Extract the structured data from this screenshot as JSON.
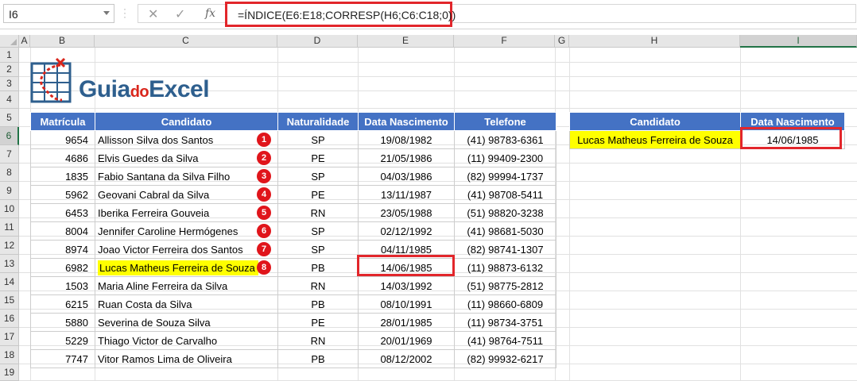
{
  "formula_bar": {
    "name_box": "I6",
    "formula": "=ÍNDICE(E6:E18;CORRESP(H6;C6:C18;0))"
  },
  "columns": [
    "A",
    "B",
    "C",
    "D",
    "E",
    "F",
    "G",
    "H",
    "I"
  ],
  "rows": [
    "1",
    "2",
    "3",
    "4",
    "5",
    "6",
    "7",
    "8",
    "9",
    "10",
    "11",
    "12",
    "13",
    "14",
    "15",
    "16",
    "17",
    "18",
    "19"
  ],
  "logo": {
    "part1": "Guia",
    "part2": "do",
    "part3": "Excel"
  },
  "main_table": {
    "headers": [
      "Matrícula",
      "Candidato",
      "Naturalidade",
      "Data Nascimento",
      "Telefone"
    ],
    "rows": [
      {
        "matricula": "9654",
        "candidato": "Allisson Silva dos Santos",
        "badge": "1",
        "nat": "SP",
        "data": "19/08/1982",
        "tel": "(41) 98783-6361"
      },
      {
        "matricula": "4686",
        "candidato": "Elvis Guedes da Silva",
        "badge": "2",
        "nat": "PE",
        "data": "21/05/1986",
        "tel": "(11) 99409-2300"
      },
      {
        "matricula": "1835",
        "candidato": "Fabio Santana da Silva Filho",
        "badge": "3",
        "nat": "SP",
        "data": "04/03/1986",
        "tel": "(82) 99994-1737"
      },
      {
        "matricula": "5962",
        "candidato": "Geovani Cabral da Silva",
        "badge": "4",
        "nat": "PE",
        "data": "13/11/1987",
        "tel": "(41) 98708-5411"
      },
      {
        "matricula": "6453",
        "candidato": "Iberika Ferreira Gouveia",
        "badge": "5",
        "nat": "RN",
        "data": "23/05/1988",
        "tel": "(51) 98820-3238"
      },
      {
        "matricula": "8004",
        "candidato": "Jennifer Caroline Hermógenes",
        "badge": "6",
        "nat": "SP",
        "data": "02/12/1992",
        "tel": "(41) 98681-5030"
      },
      {
        "matricula": "8974",
        "candidato": "Joao Victor Ferreira dos Santos",
        "badge": "7",
        "nat": "SP",
        "data": "04/11/1985",
        "tel": "(82) 98741-1307"
      },
      {
        "matricula": "6982",
        "candidato": "Lucas Matheus Ferreira de Souza",
        "badge": "8",
        "nat": "PB",
        "data": "14/06/1985",
        "tel": "(11) 98873-6132"
      },
      {
        "matricula": "1503",
        "candidato": "Maria Aline Ferreira da Silva",
        "badge": "",
        "nat": "RN",
        "data": "14/03/1992",
        "tel": "(51) 98775-2812"
      },
      {
        "matricula": "6215",
        "candidato": "Ruan Costa da Silva",
        "badge": "",
        "nat": "PB",
        "data": "08/10/1991",
        "tel": "(11) 98660-6809"
      },
      {
        "matricula": "5880",
        "candidato": "Severina de Souza Silva",
        "badge": "",
        "nat": "PE",
        "data": "28/01/1985",
        "tel": "(11) 98734-3751"
      },
      {
        "matricula": "5229",
        "candidato": "Thiago Victor de Carvalho",
        "badge": "",
        "nat": "RN",
        "data": "20/01/1969",
        "tel": "(41) 98764-7511"
      },
      {
        "matricula": "7747",
        "candidato": "Vitor Ramos Lima de Oliveira",
        "badge": "",
        "nat": "PB",
        "data": "08/12/2002",
        "tel": "(82) 99932-6217"
      }
    ]
  },
  "lookup_table": {
    "headers": [
      "Candidato",
      "Data Nascimento"
    ],
    "candidato": "Lucas Matheus Ferreira de Souza",
    "data": "14/06/1985"
  },
  "colors": {
    "header_blue": "#4472c4",
    "highlight": "#ffff00",
    "badge_red": "#e0151b",
    "box_red": "#e2262b"
  }
}
